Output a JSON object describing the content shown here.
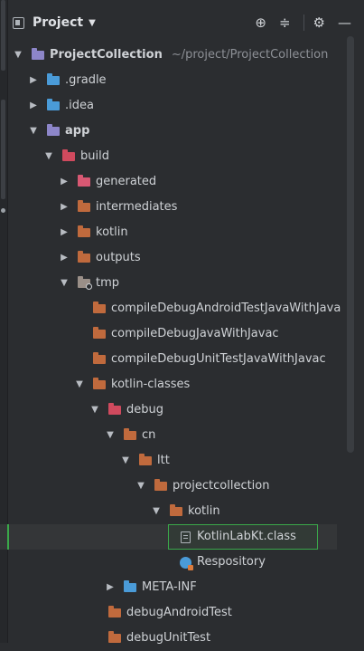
{
  "panel": {
    "title": "Project"
  },
  "toolbar": {
    "icons": [
      "locate-icon",
      "collapse-all-icon",
      "settings-icon",
      "hide-icon"
    ]
  },
  "tree": {
    "root": {
      "name": "ProjectCollection",
      "path": "~/project/ProjectCollection"
    },
    "gradle": ".gradle",
    "idea": ".idea",
    "app": "app",
    "build": "build",
    "generated": "generated",
    "intermediates": "intermediates",
    "kotlin": "kotlin",
    "outputs": "outputs",
    "tmp": "tmp",
    "compile_android_test": "compileDebugAndroidTestJavaWithJava",
    "compile_debug": "compileDebugJavaWithJavac",
    "compile_unit_test": "compileDebugUnitTestJavaWithJavac",
    "kotlin_classes": "kotlin-classes",
    "debug": "debug",
    "cn": "cn",
    "ltt": "ltt",
    "projectcollection": "projectcollection",
    "kotlin_pkg": "kotlin",
    "selected_file": "KotlinLabKt.class",
    "repository": "Respository",
    "meta_inf": "META-INF",
    "debug_android_test": "debugAndroidTest",
    "debug_unit_test": "debugUnitTest"
  },
  "colors": {
    "selection_border": "#3aa84a",
    "folder": "#c06a3d",
    "accent_blue": "#4a9bd8"
  }
}
